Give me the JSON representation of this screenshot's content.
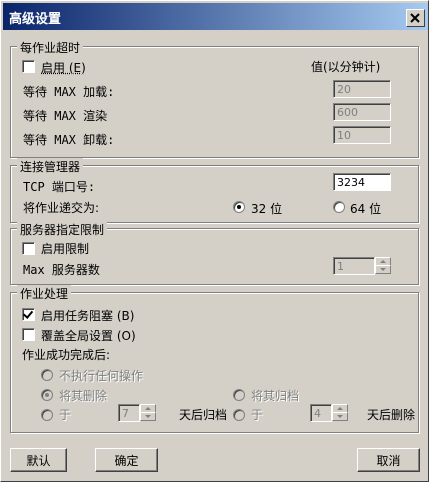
{
  "window": {
    "title": "高级设置"
  },
  "timeout": {
    "legend": "每作业超时",
    "enable_label": "启用 (E)",
    "value_header": "值(以分钟计)",
    "load_label": "等待 MAX 加载:",
    "load_value": "20",
    "render_label": "等待 MAX 渲染",
    "render_value": "600",
    "unload_label": "等待 MAX 卸载:",
    "unload_value": "10"
  },
  "connection": {
    "legend": "连接管理器",
    "port_label": "TCP 端口号:",
    "port_value": "3234",
    "submit_label": "将作业递交为:",
    "opt32": "32 位",
    "opt64": "64 位"
  },
  "server_limit": {
    "legend": "服务器指定限制",
    "enable_label": "启用限制",
    "max_label": "Max 服务器数",
    "max_value": "1"
  },
  "job": {
    "legend": "作业处理",
    "task_block_label": "启用任务阻塞 (B)",
    "override_label": "覆盖全局设置 (O)",
    "after_label": "作业成功完成后:",
    "no_action": "不执行任何操作",
    "delete": "将其删除",
    "archive": "将其归档",
    "on1": "于",
    "days1_value": "7",
    "days1_suffix": "天后归档",
    "on2": "于",
    "days2_value": "4",
    "days2_suffix": "天后删除"
  },
  "buttons": {
    "default": "默认",
    "ok": "确定",
    "cancel": "取消"
  }
}
